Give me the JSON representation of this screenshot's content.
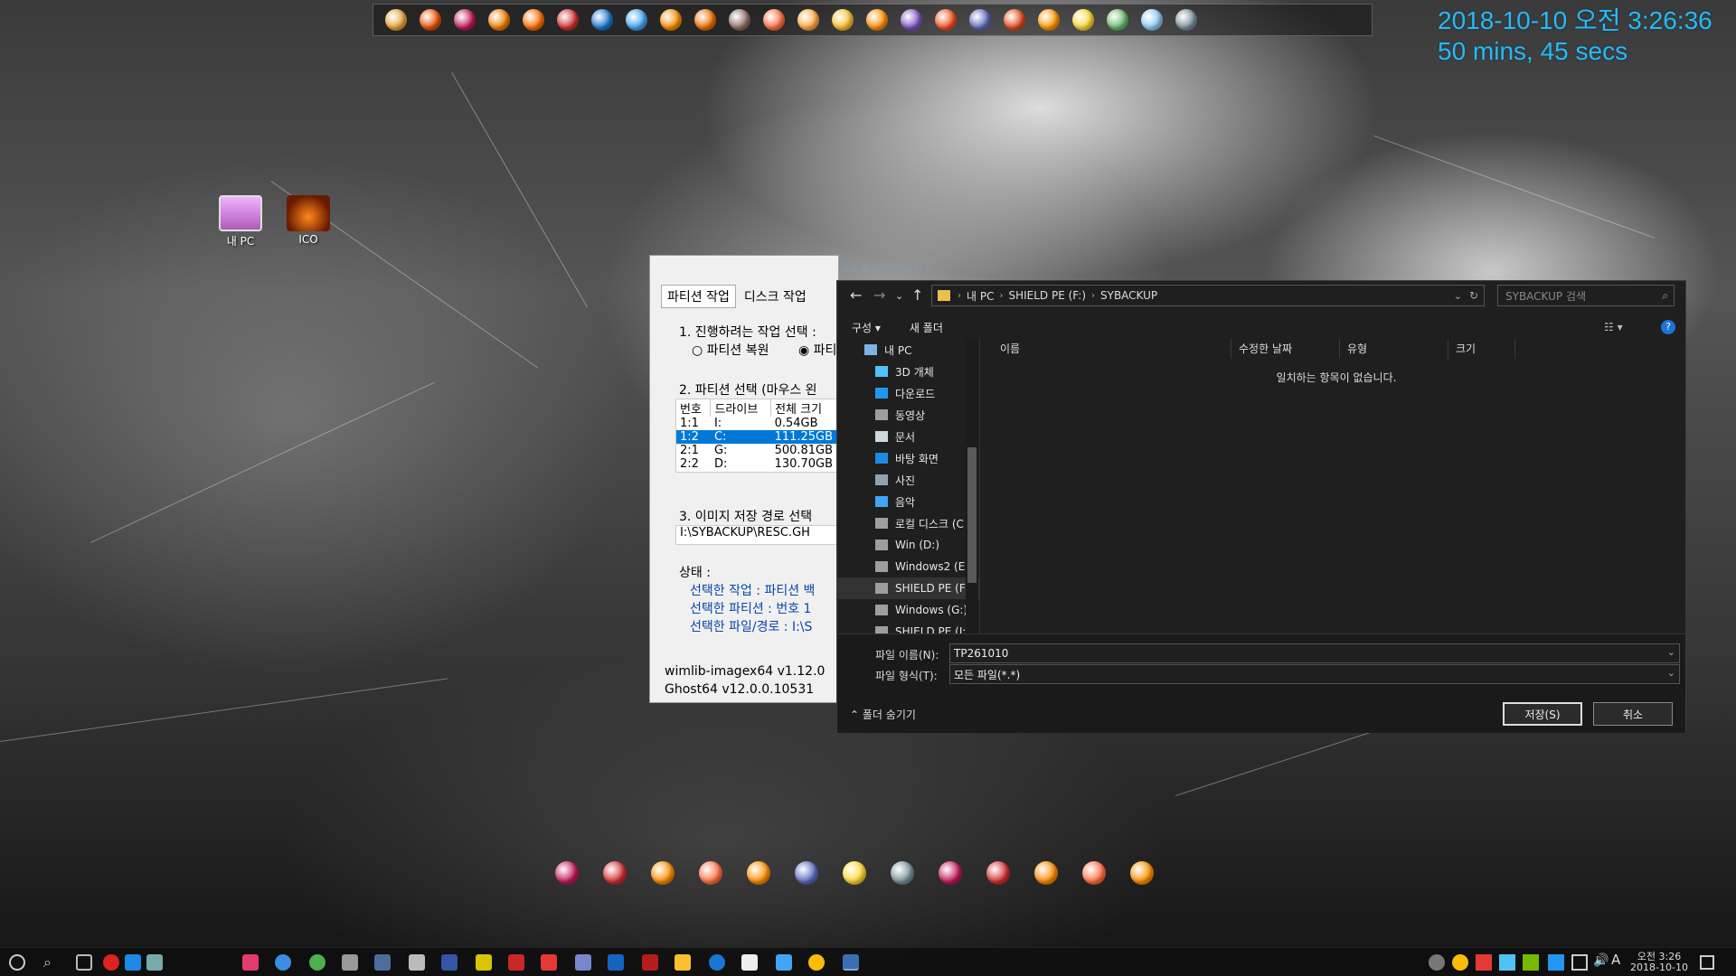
{
  "clock": {
    "line1": "2018-10-10 오전 3:26:36",
    "line2": "50 mins, 45 secs"
  },
  "top_launcher": {
    "icons": [
      "cartoon-icon",
      "folder-icon",
      "colorful-icon",
      "pencil-icon",
      "firefox-icon",
      "opera-icon",
      "maxthon-icon",
      "globe-icon",
      "browser-icon",
      "swirl-icon",
      "gear-icon",
      "people-icon",
      "flame-icon",
      "chrome-icon",
      "bird-icon",
      "orb-icon",
      "firefox-icon",
      "globe-icon",
      "paint-icon",
      "firefox-icon",
      "pencil-icon",
      "search-icon",
      "drop-icon",
      "network-icon"
    ]
  },
  "desktop_icons": [
    {
      "label": "내 PC",
      "icon": "computer-icon"
    },
    {
      "label": "ICO",
      "icon": "image-icon"
    }
  ],
  "ghost": {
    "title": "CGI 3.2.3 By Clone...  > 연결... 저장 경로를 선택하십시오",
    "tabs": [
      "파티션 작업",
      "디스크 작업"
    ],
    "step1": "1. 진행하려는 작업 선택 :",
    "radio_restore": "파티션 복원",
    "radio_backup": "파티",
    "step2": "2. 파티션 선택 (마우스 왼",
    "table_headers": [
      "번호",
      "드라이브",
      "전체 크기"
    ],
    "rows": [
      [
        "1:1",
        "I:",
        "0.54GB"
      ],
      [
        "1:2",
        "C:",
        "111.25GB"
      ],
      [
        "2:1",
        "G:",
        "500.81GB"
      ],
      [
        "2:2",
        "D:",
        "130.70GB"
      ]
    ],
    "step3": "3. 이미지 저장 경로 선택",
    "path": "I:\\SYBACKUP\\RESC.GH",
    "status_label": "상태 :",
    "status_lines": [
      "선택한 작업 : 파티션 백",
      "선택한 파티션 :  번호 1",
      "선택한 파일/경로 : I:\\S"
    ],
    "ver1": "wimlib-imagex64 v1.12.0",
    "ver2": "Ghost64 v12.0.0.10531"
  },
  "dialog": {
    "breadcrumb": [
      "내 PC",
      "SHIELD PE (F:)",
      "SYBACKUP"
    ],
    "search_placeholder": "SYBACKUP 검색",
    "organize": "구성 ▾",
    "new_folder": "새 폴더",
    "sidebar": [
      {
        "label": "내 PC",
        "icon": "computer-icon"
      },
      {
        "label": "3D 개체",
        "icon": "cube-icon"
      },
      {
        "label": "다운로드",
        "icon": "download-icon"
      },
      {
        "label": "동영상",
        "icon": "video-icon"
      },
      {
        "label": "문서",
        "icon": "document-icon"
      },
      {
        "label": "바탕 화면",
        "icon": "desktop-icon"
      },
      {
        "label": "사진",
        "icon": "picture-icon"
      },
      {
        "label": "음악",
        "icon": "music-icon"
      },
      {
        "label": "로컬 디스크 (C",
        "icon": "drive-icon"
      },
      {
        "label": "Win (D:)",
        "icon": "drive-icon"
      },
      {
        "label": "Windows2 (E:",
        "icon": "drive-icon"
      },
      {
        "label": "SHIELD PE (F",
        "icon": "drive-icon"
      },
      {
        "label": "Windows (G:)",
        "icon": "drive-icon"
      },
      {
        "label": "SHIELD PE (I:",
        "icon": "drive-icon"
      }
    ],
    "columns": [
      "이름",
      "수정한 날짜",
      "유형",
      "크기"
    ],
    "empty_text": "일치하는 항목이 없습니다.",
    "filename_label": "파일 이름(N):",
    "filename_value": "TP261010",
    "filetype_label": "파일 형식(T):",
    "filetype_value": "모든 파일(*.*)",
    "hide_folders": "폴더 숨기기",
    "save": "저장(S)",
    "cancel": "취소"
  },
  "dock_icons": [
    "folder-icon",
    "firefox-icon",
    "globe-icon",
    "swirl-icon",
    "cartoon-icon",
    "orb-icon",
    "color-ball-icon",
    "ball-icon",
    "paint-icon",
    "tools-icon",
    "swirl-icon",
    "orb-icon",
    "orb-icon"
  ],
  "taskbar": {
    "time": "오전 3:26",
    "date": "2018-10-10",
    "ime": "A"
  }
}
